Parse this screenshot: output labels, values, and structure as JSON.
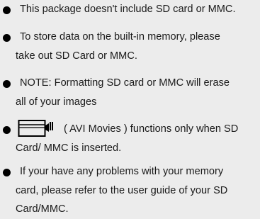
{
  "notes": [
    {
      "line1": "This package doesn't include SD card or MMC."
    },
    {
      "line1": "To store data on the built-in memory, please",
      "line2": "take out SD Card or MMC."
    },
    {
      "line1": "NOTE: Formatting SD card or MMC will erase",
      "line2": "all of your images"
    },
    {
      "icon": "movie-camera-icon",
      "line1": "( AVI Movies ) functions only when SD",
      "line2": "Card/ MMC is inserted."
    },
    {
      "line1": "If your have any problems with your memory",
      "line2": "card, please refer to the user guide of your SD",
      "line3": "Card/MMC."
    }
  ]
}
